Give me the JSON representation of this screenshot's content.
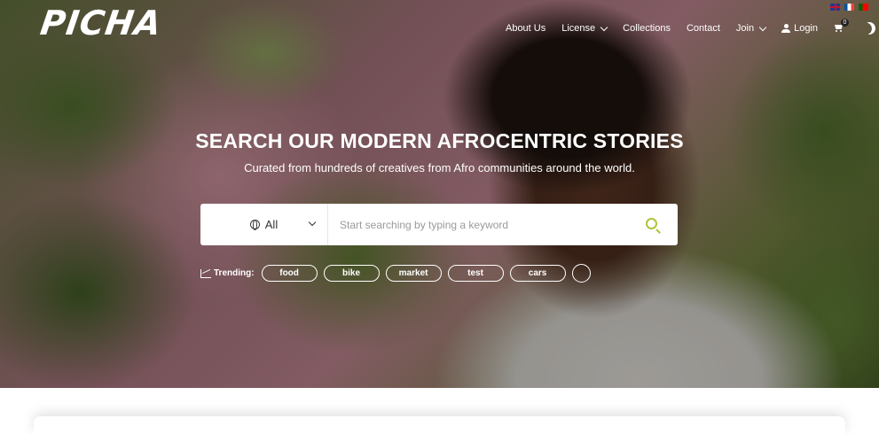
{
  "logo": {
    "text": "PICHA"
  },
  "languages": [
    {
      "code": "en",
      "icon": "uk-flag-icon"
    },
    {
      "code": "fr",
      "icon": "france-flag-icon"
    },
    {
      "code": "pt",
      "icon": "portugal-flag-icon"
    }
  ],
  "nav": {
    "about": "About Us",
    "license": "License",
    "collections": "Collections",
    "contact": "Contact",
    "join": "Join",
    "login": "Login",
    "cart_count": "0"
  },
  "hero": {
    "title": "SEARCH OUR MODERN AFROCENTRIC STORIES",
    "subtitle": "Curated from hundreds of creatives from Afro communities around the world."
  },
  "search": {
    "category": "All",
    "placeholder": "Start searching by typing a keyword",
    "accent_color": "#a9c638"
  },
  "trending": {
    "label": "Trending:",
    "tags": [
      "food",
      "bike",
      "market",
      "test",
      "cars",
      ""
    ]
  }
}
